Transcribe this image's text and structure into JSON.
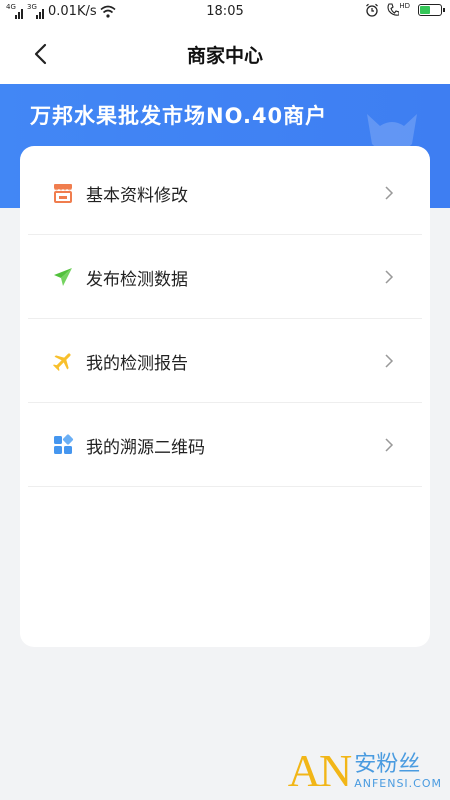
{
  "status_bar": {
    "net1": "4G",
    "net2": "3G",
    "speed": "0.01K/s",
    "time": "18:05",
    "hd": "HD",
    "battery_level": 0.45,
    "battery_color": "#35c759"
  },
  "nav": {
    "title": "商家中心",
    "back_icon": "chevron-left-icon"
  },
  "banner": {
    "title": "万邦水果批发市场NO.40商户",
    "color": "#4287f5"
  },
  "menu": [
    {
      "label": "基本资料修改",
      "icon": "shop-icon",
      "color": "#f07d4e"
    },
    {
      "label": "发布检测数据",
      "icon": "paper-plane-icon",
      "color": "#52c13c"
    },
    {
      "label": "我的检测报告",
      "icon": "airplane-icon",
      "color": "#f8c02c"
    },
    {
      "label": "我的溯源二维码",
      "icon": "qr-code-icon",
      "color": "#4596ef"
    }
  ],
  "watermark": {
    "logo": "AN",
    "cn": "安粉丝",
    "en": "ANFENSI.COM"
  }
}
